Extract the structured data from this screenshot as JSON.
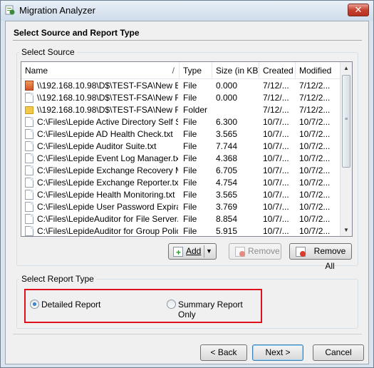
{
  "window": {
    "title": "Migration Analyzer",
    "close_glyph": "✕"
  },
  "page": {
    "heading": "Select Source and Report Type"
  },
  "source_group": {
    "label": "Select Source",
    "columns": [
      "Name",
      "Type",
      "Size (in KB)",
      "Created",
      "Modified"
    ],
    "sort_glyph": "/",
    "rows": [
      {
        "icon": "server-share-icon",
        "name": "\\\\192.168.10.98\\D$\\TEST-FSA\\New Bit...",
        "type": "File",
        "size": "0.000",
        "created": "7/12/...",
        "modified": "7/12/2..."
      },
      {
        "icon": "file-icon",
        "name": "\\\\192.168.10.98\\D$\\TEST-FSA\\New Fo...",
        "type": "File",
        "size": "0.000",
        "created": "7/12/...",
        "modified": "7/12/2..."
      },
      {
        "icon": "folder-icon",
        "name": "\\\\192.168.10.98\\D$\\TEST-FSA\\New Fo...",
        "type": "Folder",
        "size": "",
        "created": "7/12/...",
        "modified": "7/12/2..."
      },
      {
        "icon": "file-icon",
        "name": "C:\\Files\\Lepide Active Directory Self Se...",
        "type": "File",
        "size": "6.300",
        "created": "10/7/...",
        "modified": "10/7/2..."
      },
      {
        "icon": "file-icon",
        "name": "C:\\Files\\Lepide AD Health Check.txt",
        "type": "File",
        "size": "3.565",
        "created": "10/7/...",
        "modified": "10/7/2..."
      },
      {
        "icon": "file-icon",
        "name": "C:\\Files\\Lepide Auditor Suite.txt",
        "type": "File",
        "size": "7.744",
        "created": "10/7/...",
        "modified": "10/7/2..."
      },
      {
        "icon": "file-icon",
        "name": "C:\\Files\\Lepide Event Log Manager.txt",
        "type": "File",
        "size": "4.368",
        "created": "10/7/...",
        "modified": "10/7/2..."
      },
      {
        "icon": "file-icon",
        "name": "C:\\Files\\Lepide Exchange Recovery Ma...",
        "type": "File",
        "size": "6.705",
        "created": "10/7/...",
        "modified": "10/7/2..."
      },
      {
        "icon": "file-icon",
        "name": "C:\\Files\\Lepide Exchange Reporter.txt",
        "type": "File",
        "size": "4.754",
        "created": "10/7/...",
        "modified": "10/7/2..."
      },
      {
        "icon": "file-icon",
        "name": "C:\\Files\\Lepide Health Monitoring.txt",
        "type": "File",
        "size": "3.565",
        "created": "10/7/...",
        "modified": "10/7/2..."
      },
      {
        "icon": "file-icon",
        "name": "C:\\Files\\Lepide User Password Expirati...",
        "type": "File",
        "size": "3.769",
        "created": "10/7/...",
        "modified": "10/7/2..."
      },
      {
        "icon": "file-icon",
        "name": "C:\\Files\\LepideAuditor for File Server.txt",
        "type": "File",
        "size": "8.854",
        "created": "10/7/...",
        "modified": "10/7/2..."
      },
      {
        "icon": "file-icon",
        "name": "C:\\Files\\LepideAuditor for Group Policy...",
        "type": "File",
        "size": "5.915",
        "created": "10/7/...",
        "modified": "10/7/2..."
      }
    ],
    "add_label": "Add",
    "remove_label": "Remove",
    "remove_all_label": "Remove All"
  },
  "report_group": {
    "label": "Select Report Type",
    "options": [
      {
        "label": "Detailed Report",
        "selected": true
      },
      {
        "label": "Summary Report Only",
        "selected": false
      }
    ]
  },
  "footer": {
    "back_label": "< Back",
    "next_label": "Next >",
    "cancel_label": "Cancel"
  },
  "colors": {
    "highlight_border": "#e0101c",
    "window_frame": "#dbe4ee"
  }
}
